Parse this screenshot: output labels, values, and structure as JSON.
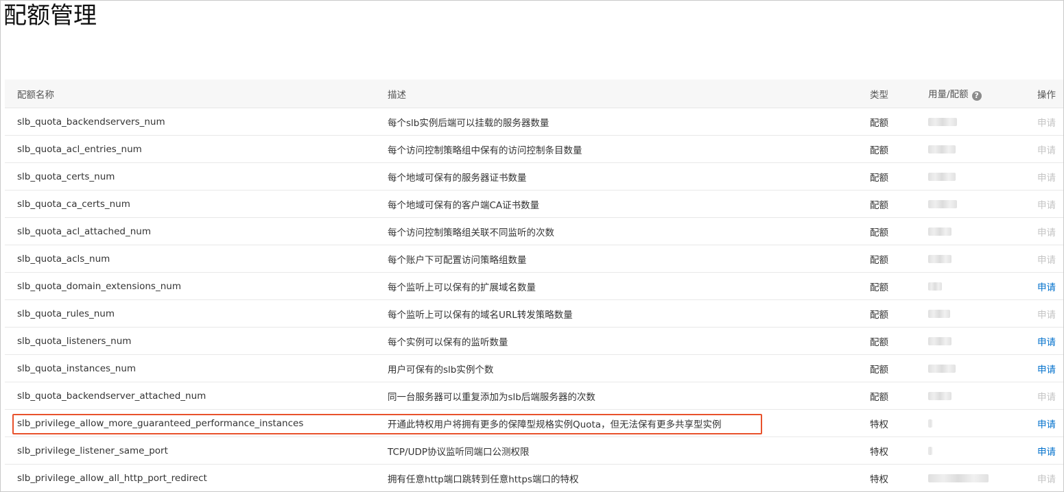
{
  "page": {
    "title": "配额管理"
  },
  "table": {
    "headers": {
      "name": "配额名称",
      "desc": "描述",
      "type": "类型",
      "usage": "用量/配额",
      "op": "操作"
    },
    "help_icon": "question-circle-icon",
    "rows": [
      {
        "name": "slb_quota_backendservers_num",
        "desc": "每个slb实例后端可以挂载的服务器数量",
        "type": "配额",
        "op": "申请",
        "op_enabled": false
      },
      {
        "name": "slb_quota_acl_entries_num",
        "desc": "每个访问控制策略组中保有的访问控制条目数量",
        "type": "配额",
        "op": "申请",
        "op_enabled": false
      },
      {
        "name": "slb_quota_certs_num",
        "desc": "每个地域可保有的服务器证书数量",
        "type": "配额",
        "op": "申请",
        "op_enabled": false
      },
      {
        "name": "slb_quota_ca_certs_num",
        "desc": "每个地域可保有的客户端CA证书数量",
        "type": "配额",
        "op": "申请",
        "op_enabled": false
      },
      {
        "name": "slb_quota_acl_attached_num",
        "desc": "每个访问控制策略组关联不同监听的次数",
        "type": "配额",
        "op": "申请",
        "op_enabled": false
      },
      {
        "name": "slb_quota_acls_num",
        "desc": "每个账户下可配置访问策略组数量",
        "type": "配额",
        "op": "申请",
        "op_enabled": false
      },
      {
        "name": "slb_quota_domain_extensions_num",
        "desc": "每个监听上可以保有的扩展域名数量",
        "type": "配额",
        "op": "申请",
        "op_enabled": true
      },
      {
        "name": "slb_quota_rules_num",
        "desc": "每个监听上可以保有的域名URL转发策略数量",
        "type": "配额",
        "op": "申请",
        "op_enabled": false
      },
      {
        "name": "slb_quota_listeners_num",
        "desc": "每个实例可以保有的监听数量",
        "type": "配额",
        "op": "申请",
        "op_enabled": true
      },
      {
        "name": "slb_quota_instances_num",
        "desc": "用户可保有的slb实例个数",
        "type": "配额",
        "op": "申请",
        "op_enabled": true
      },
      {
        "name": "slb_quota_backendserver_attached_num",
        "desc": "同一台服务器可以重复添加为slb后端服务器的次数",
        "type": "配额",
        "op": "申请",
        "op_enabled": false
      },
      {
        "name": "slb_privilege_allow_more_guaranteed_performance_instances",
        "desc": "开通此特权用户将拥有更多的保障型规格实例Quota，但无法保有更多共享型实例",
        "type": "特权",
        "op": "申请",
        "op_enabled": true
      },
      {
        "name": "slb_privilege_listener_same_port",
        "desc": "TCP/UDP协议监听同端口公测权限",
        "type": "特权",
        "op": "申请",
        "op_enabled": true
      },
      {
        "name": "slb_privilege_allow_all_http_port_redirect",
        "desc": "拥有任意http端口跳转到任意https端口的特权",
        "type": "特权",
        "op": "申请",
        "op_enabled": false
      }
    ]
  },
  "highlight": {
    "row_index": 11,
    "color": "#e8512b"
  },
  "colors": {
    "link": "#0070cc",
    "disabled": "#c4c4c4"
  }
}
